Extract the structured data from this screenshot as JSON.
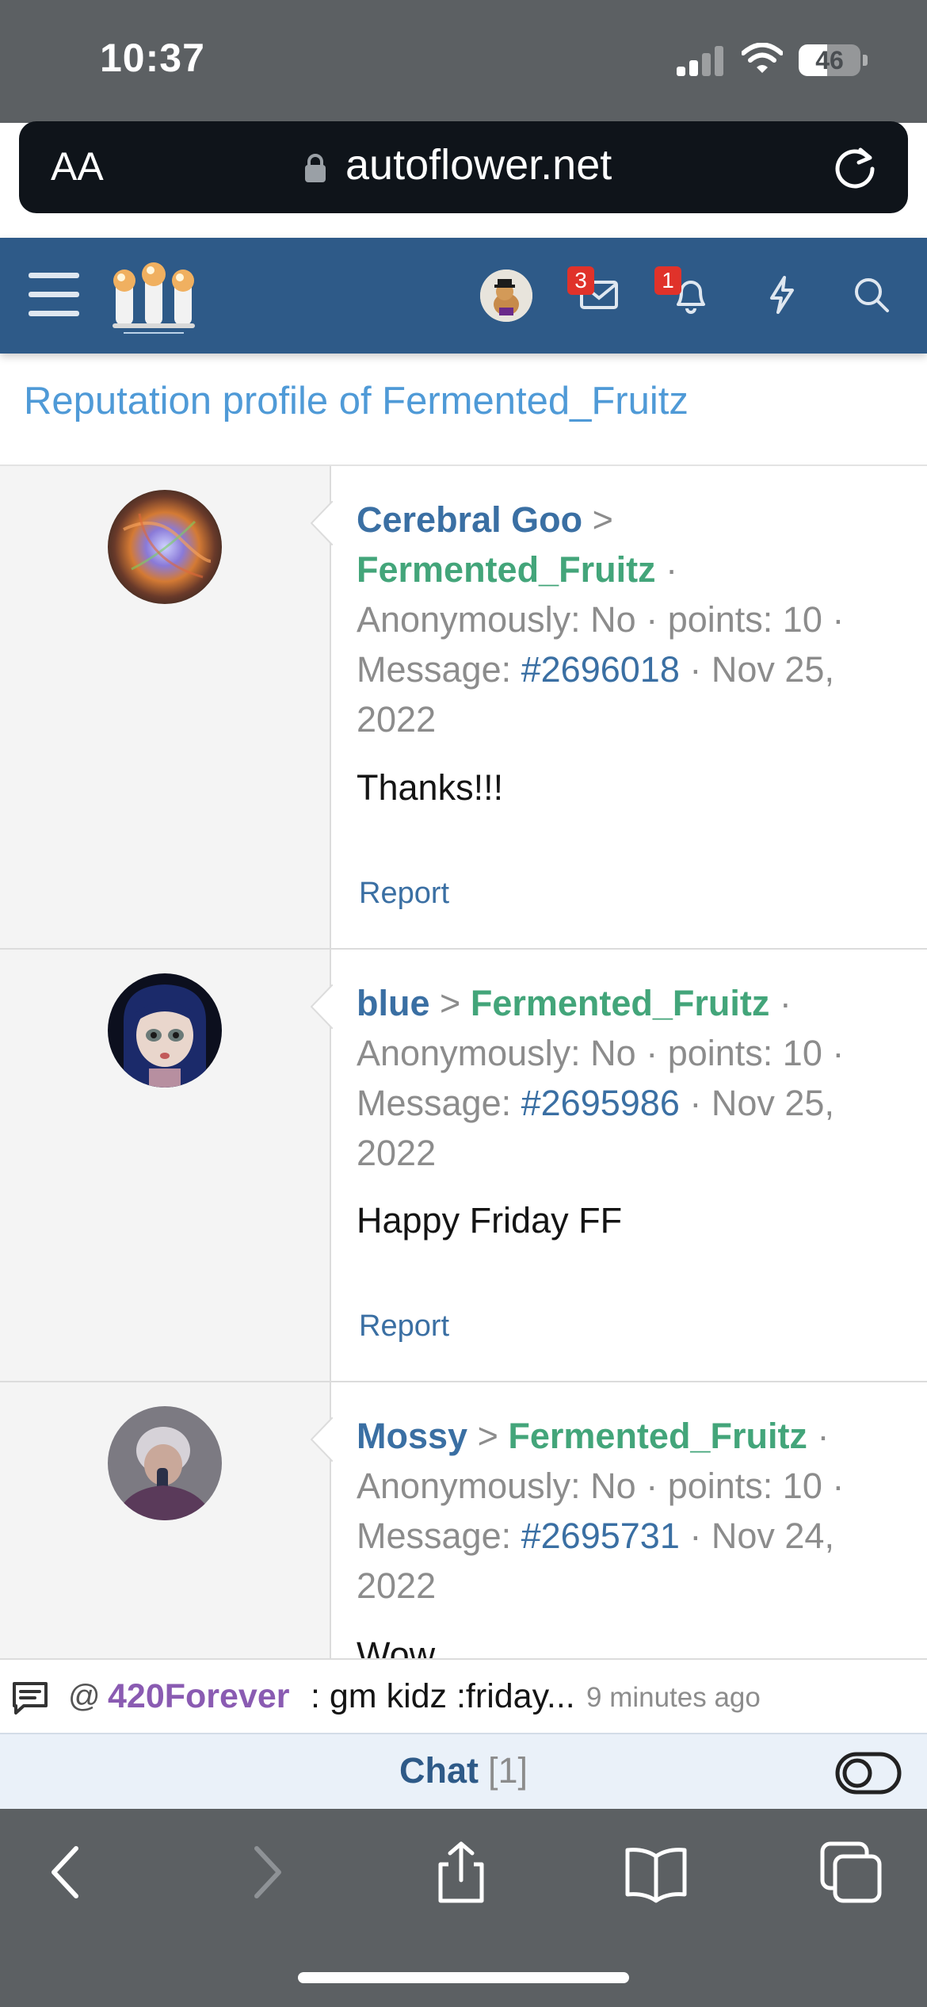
{
  "status_bar": {
    "time": "10:37",
    "battery": "46",
    "battery_level": 0.46
  },
  "browser": {
    "text_size_label": "AA",
    "url": "autoflower.net"
  },
  "header": {
    "messages_badge": "3",
    "alerts_badge": "1"
  },
  "page": {
    "title": "Reputation profile of Fermented_Fruitz"
  },
  "entries": [
    {
      "sender": "Cerebral Goo",
      "separator": ">",
      "receiver": "Fermented_Fruitz",
      "dot": "·",
      "anon_label": "Anonymously: No",
      "points": "points: 10",
      "message_label": "Message:",
      "message_id": "#2696018",
      "date": "Nov 25, 2022",
      "message": "Thanks!!!",
      "report": "Report"
    },
    {
      "sender": "blue",
      "separator": ">",
      "receiver": "Fermented_Fruitz",
      "dot": "·",
      "anon_label": "Anonymously: No",
      "points": "points: 10",
      "message_label": "Message:",
      "message_id": "#2695986",
      "date": "Nov 25, 2022",
      "message": "Happy Friday FF",
      "report": "Report"
    },
    {
      "sender": "Mossy",
      "separator": ">",
      "receiver": "Fermented_Fruitz",
      "dot": "·",
      "anon_label": "Anonymously: No",
      "points": "points: 10",
      "message_label": "Message:",
      "message_id": "#2695731",
      "date": "Nov 24, 2022",
      "message": "Wow"
    }
  ],
  "chat": {
    "at": "@",
    "latest_user": "420Forever",
    "latest_text": ": gm kidz :friday...",
    "latest_time": "9 minutes ago",
    "label": "Chat",
    "count": "[1]"
  },
  "colors": {
    "header_bg": "#2e5a88",
    "link": "#3a6fa3",
    "receiver": "#43a57a",
    "title": "#4f9ad7",
    "chat_user": "#8a5bb2",
    "badge": "#e0322a"
  },
  "icons": [
    "signal-icon",
    "wifi-icon",
    "battery-icon",
    "lock-icon",
    "reload-icon",
    "menu-icon",
    "site-logo",
    "messages-icon",
    "bell-icon",
    "bolt-icon",
    "search-icon",
    "chat-icon",
    "toggle-icon",
    "back-icon",
    "forward-icon",
    "share-icon",
    "bookmarks-icon",
    "tabs-icon"
  ]
}
